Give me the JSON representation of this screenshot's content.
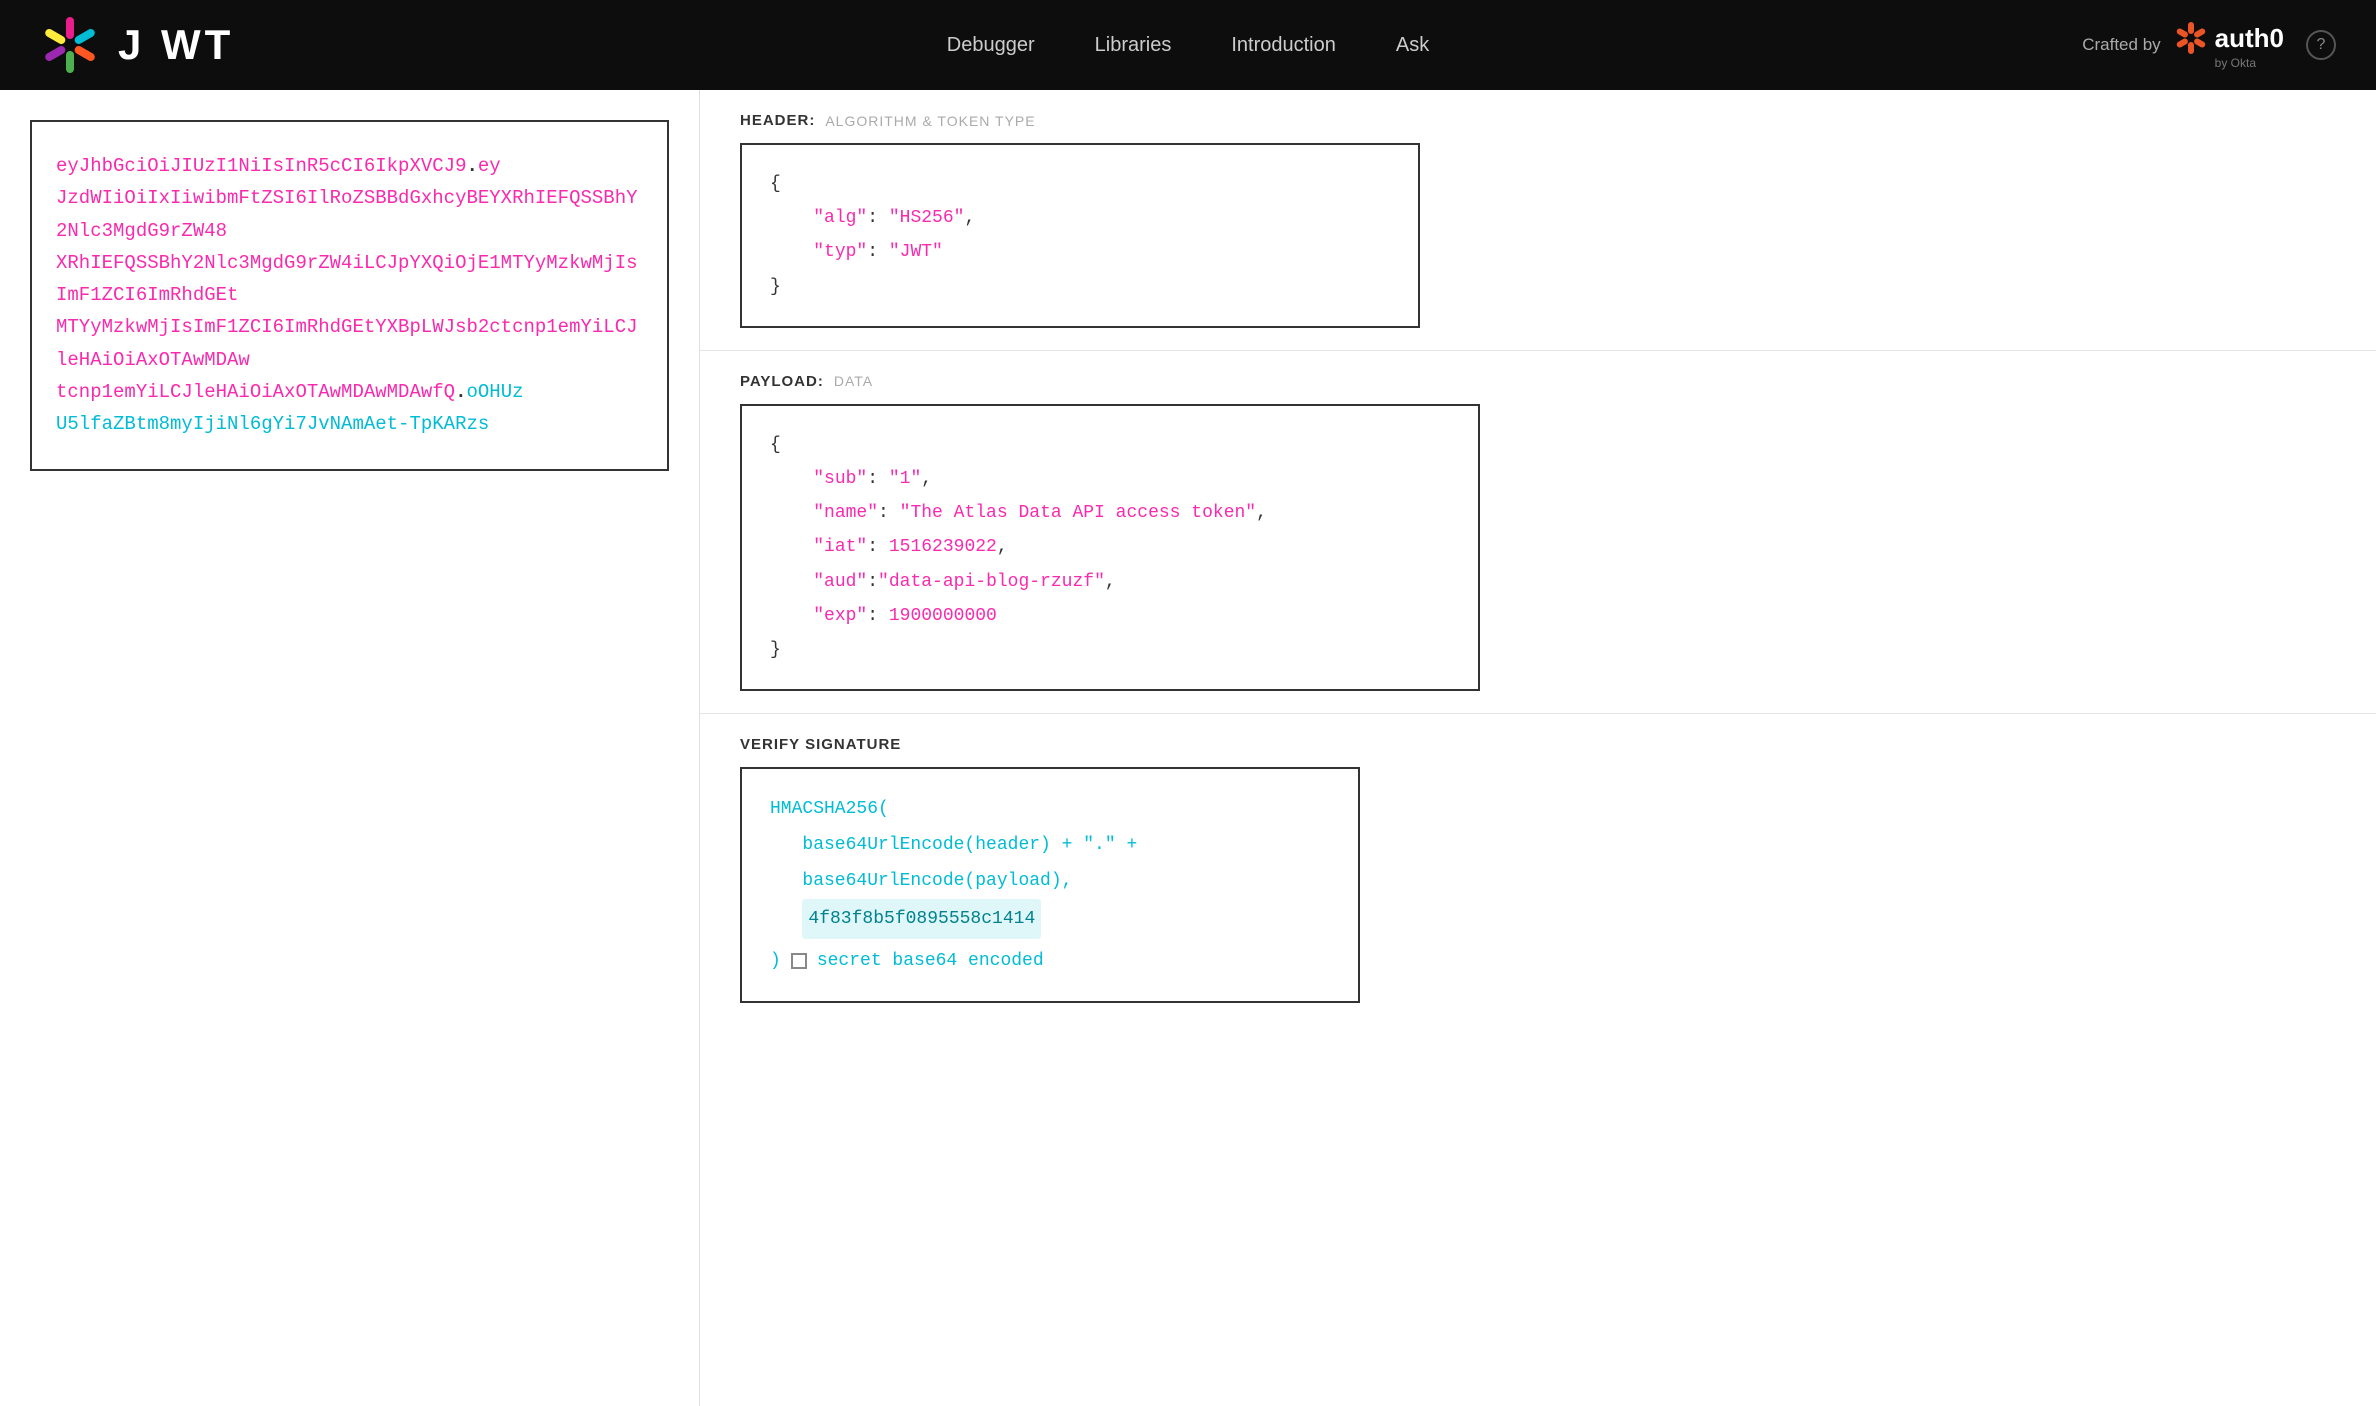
{
  "navbar": {
    "logo_text": "J WT",
    "nav_links": [
      {
        "label": "Debugger",
        "id": "debugger"
      },
      {
        "label": "Libraries",
        "id": "libraries"
      },
      {
        "label": "Introduction",
        "id": "introduction"
      },
      {
        "label": "Ask",
        "id": "ask"
      }
    ],
    "crafted_by_label": "Crafted by",
    "auth0_name": "auth0",
    "auth0_okta": "by Okta",
    "help_icon": "?"
  },
  "left_panel": {
    "token_part1": "eyJhbGciOiJIUzI1NiIsInR5cCI6IkpXVCJ9",
    "dot1": ".",
    "token_part2": "eyJzdWIiOiIxIiwibmFtZSI6IlRoZSBBdGxhcyBEYXRhIEFQSSBhY2Nlc3MgdG9rZW4iLCJpYXQiOjE1MTYyMzkwMjIsImF1ZCI6ImRhdGEtYXBpLWJsb2ctcnp1emYiLCJleHAiOiAxOTAwMDAwMDAwfQ",
    "dot2": ".",
    "token_part3": "oOHUzU5lfaZBtm8myIjiNl6gYi7JvNAmAet-TpKARzs"
  },
  "right_panel": {
    "header_section": {
      "label": "HEADER:",
      "sublabel": "ALGORITHM & TOKEN TYPE",
      "code": {
        "alg_key": "\"alg\"",
        "alg_value": "\"HS256\"",
        "typ_key": "\"typ\"",
        "typ_value": "\"JWT\""
      }
    },
    "payload_section": {
      "label": "PAYLOAD:",
      "sublabel": "DATA",
      "code": {
        "sub_key": "\"sub\"",
        "sub_value": "\"1\"",
        "name_key": "\"name\"",
        "name_value": "\"The Atlas Data API access token\"",
        "iat_key": "\"iat\"",
        "iat_value": "1516239022",
        "aud_key": "\"aud\"",
        "aud_value": "\"data-api-blog-rzuzf\"",
        "exp_key": "\"exp\"",
        "exp_value": "1900000000"
      }
    },
    "verify_section": {
      "label": "VERIFY SIGNATURE",
      "func_name": "HMACSHA256(",
      "line1": "base64UrlEncode(header) + \".\" +",
      "line2": "base64UrlEncode(payload),",
      "secret_value": "4f83f8b5f0895558c1414",
      "closing": ")",
      "secret_label": "secret base64 encoded"
    }
  }
}
